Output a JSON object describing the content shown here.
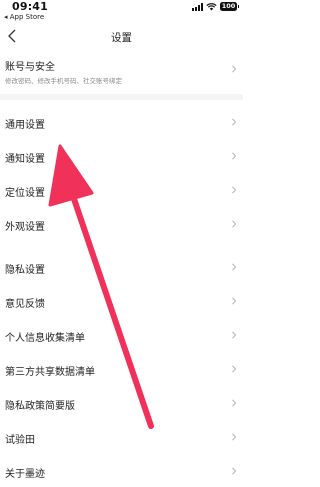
{
  "status_bar": {
    "time": "09:41",
    "back_label": "◂ App Store",
    "battery": "100"
  },
  "nav": {
    "title": "设置"
  },
  "account": {
    "label": "账号与安全",
    "subtitle": "修改密码、修改手机号码、社交账号绑定"
  },
  "settings": {
    "items": [
      {
        "label": "通用设置"
      },
      {
        "label": "通知设置"
      },
      {
        "label": "定位设置"
      },
      {
        "label": "外观设置"
      },
      {
        "label": "隐私设置"
      },
      {
        "label": "意见反馈"
      },
      {
        "label": "个人信息收集清单"
      },
      {
        "label": "第三方共享数据清单"
      },
      {
        "label": "隐私政策简要版"
      },
      {
        "label": "试验田"
      },
      {
        "label": "关于墨迹"
      }
    ]
  },
  "annotation": {
    "arrow_color": "#f0325a",
    "target": "通知设置"
  },
  "icons": [
    "chevron-left-icon",
    "chevron-right-icon",
    "signal-icon",
    "wifi-icon",
    "battery-icon",
    "red-arrow-annotation"
  ]
}
